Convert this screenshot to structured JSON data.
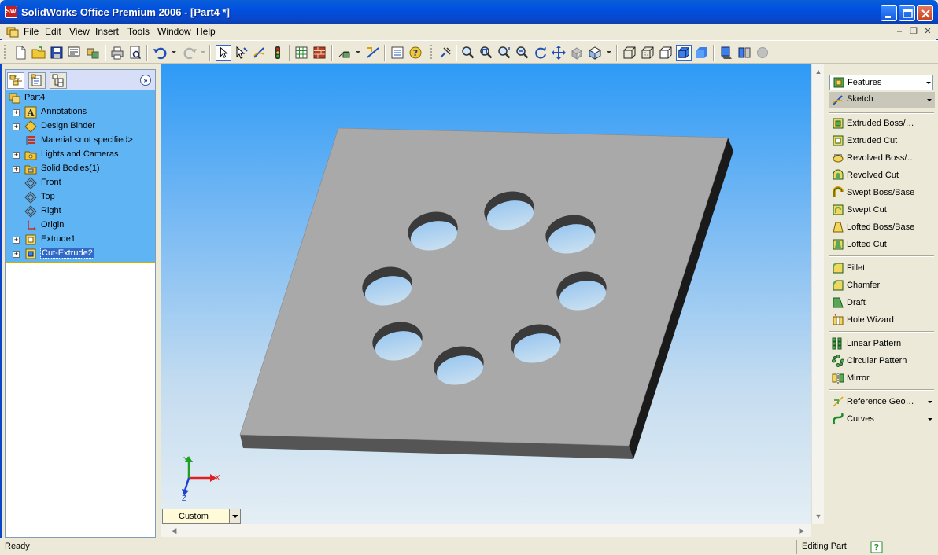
{
  "window": {
    "title": "SolidWorks Office Premium 2006 - [Part4 *]",
    "app_icon_text": "SW"
  },
  "menu": [
    "File",
    "Edit",
    "View",
    "Insert",
    "Tools",
    "Window",
    "Help"
  ],
  "feature_tree": {
    "root": "Part4",
    "items": [
      {
        "label": "Annotations",
        "expandable": true,
        "icon": "annotations-icon"
      },
      {
        "label": "Design Binder",
        "expandable": true,
        "icon": "design-binder-icon"
      },
      {
        "label": "Material <not specified>",
        "expandable": false,
        "icon": "material-icon"
      },
      {
        "label": "Lights and Cameras",
        "expandable": true,
        "icon": "lights-cameras-icon"
      },
      {
        "label": "Solid Bodies(1)",
        "expandable": true,
        "icon": "solid-bodies-icon"
      },
      {
        "label": "Front",
        "expandable": false,
        "icon": "plane-icon"
      },
      {
        "label": "Top",
        "expandable": false,
        "icon": "plane-icon"
      },
      {
        "label": "Right",
        "expandable": false,
        "icon": "plane-icon"
      },
      {
        "label": "Origin",
        "expandable": false,
        "icon": "origin-icon"
      },
      {
        "label": "Extrude1",
        "expandable": true,
        "icon": "extrude-icon"
      },
      {
        "label": "Cut-Extrude2",
        "expandable": true,
        "icon": "cut-extrude-icon",
        "selected": true
      }
    ]
  },
  "viewport": {
    "view_orientation": "Custom",
    "triad": {
      "x": "X",
      "y": "Y",
      "z": "Z"
    }
  },
  "command_manager": {
    "selected": "Features",
    "sketch_label": "Sketch",
    "groups": [
      [
        "Extruded Boss/Base",
        "Extruded Cut",
        "Revolved Boss/Base",
        "Revolved Cut",
        "Swept Boss/Base",
        "Swept Cut",
        "Lofted Boss/Base",
        "Lofted Cut"
      ],
      [
        "Fillet",
        "Chamfer",
        "Draft",
        "Hole Wizard"
      ],
      [
        "Linear Pattern",
        "Circular Pattern",
        "Mirror"
      ],
      [
        "Reference Geometry",
        "Curves"
      ]
    ]
  },
  "status": {
    "text": "Ready",
    "mode": "Editing Part"
  },
  "colors": {
    "title_blue": "#0a50e0",
    "tree_background": "#5fb4f4",
    "selection": "#316ac5",
    "part_gray": "#a9a9a9"
  }
}
